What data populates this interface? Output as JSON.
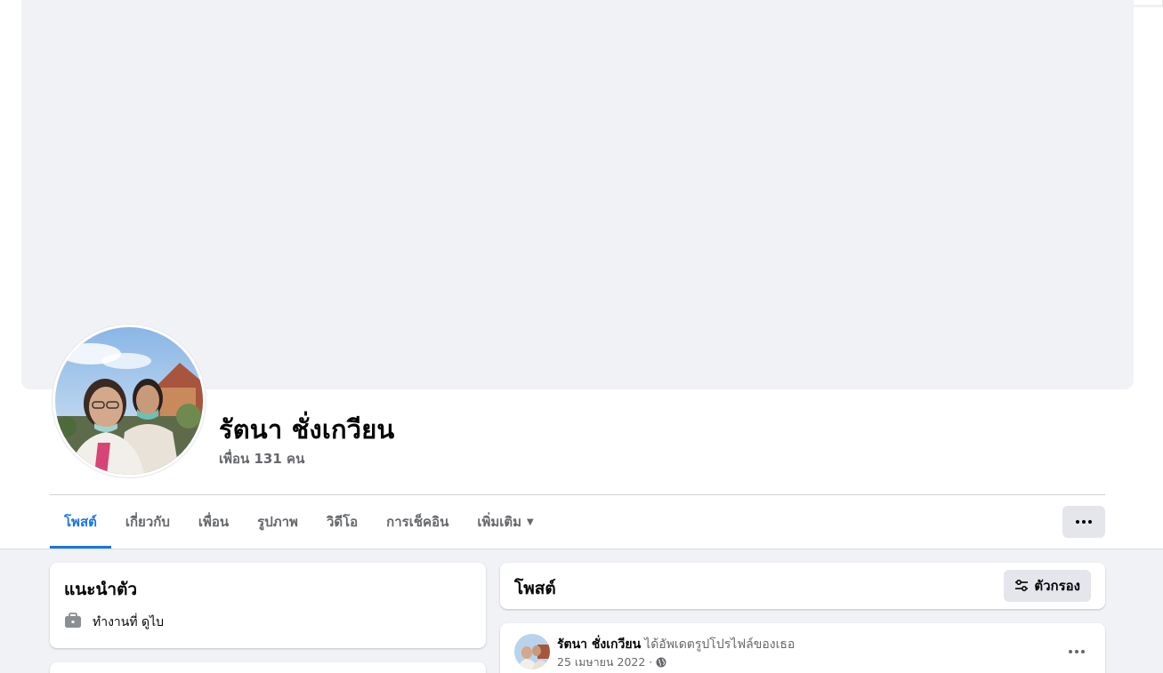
{
  "profile": {
    "name": "รัตนา ชั่งเกวียน",
    "friends": "เพื่อน 131 คน",
    "avatar_icon": "profile-photo-two-women-selfie"
  },
  "tabs": [
    {
      "label": "โพสต์",
      "active": true
    },
    {
      "label": "เกี่ยวกับ",
      "active": false
    },
    {
      "label": "เพื่อน",
      "active": false
    },
    {
      "label": "รูปภาพ",
      "active": false
    },
    {
      "label": "วิดีโอ",
      "active": false
    },
    {
      "label": "การเช็คอิน",
      "active": false
    },
    {
      "label": "เพิ่มเติม",
      "active": false,
      "dropdown": true
    }
  ],
  "intro": {
    "title": "แนะนำตัว",
    "work": "ทำงานที่ ดูไบ",
    "work_icon": "briefcase-icon"
  },
  "posts": {
    "title": "โพสต์",
    "filter_label": "ตัวกรอง",
    "filter_icon": "filter-sliders-icon",
    "items": [
      {
        "author": "รัตนา ชั่งเกวียน",
        "action": "ได้อัพเดตรูปโปรไฟล์ของเธอ",
        "date": "25 เมษายน 2022 ·",
        "privacy_icon": "globe-icon"
      }
    ]
  },
  "colors": {
    "accent": "#1b74e4",
    "background": "#f0f2f5",
    "secondary_text": "#65676b",
    "button_gray": "#e4e6eb"
  }
}
